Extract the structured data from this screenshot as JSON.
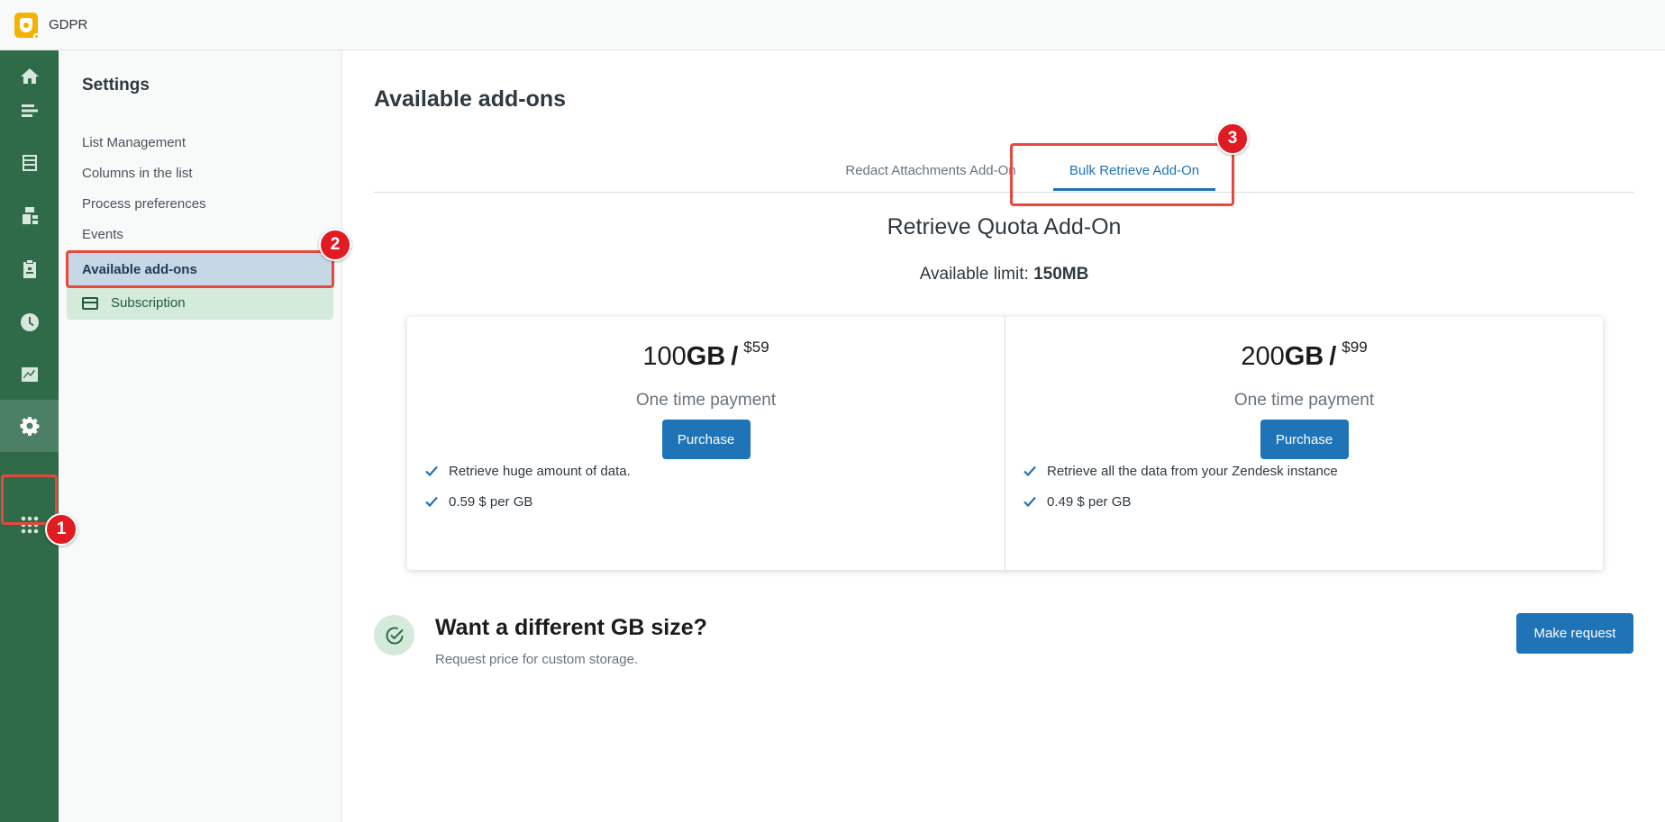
{
  "app": {
    "title": "GDPR",
    "logo_icon": "gdpr-shield-icon"
  },
  "rail": {
    "items": [
      {
        "icon": "home-icon"
      },
      {
        "icon": "list-icon"
      },
      {
        "icon": "inbox-icon"
      },
      {
        "icon": "users-icon"
      },
      {
        "icon": "clipboard-icon"
      },
      {
        "icon": "clock-icon"
      },
      {
        "icon": "chart-icon"
      },
      {
        "icon": "user-lock-icon"
      },
      {
        "icon": "gear-icon",
        "active": true
      },
      {
        "icon": "apps-grid-icon"
      }
    ]
  },
  "settings": {
    "title": "Settings",
    "items": [
      {
        "label": "List Management"
      },
      {
        "label": "Columns in the list"
      },
      {
        "label": "Process preferences"
      },
      {
        "label": "Events"
      },
      {
        "label": "Available add-ons",
        "selected": true
      },
      {
        "label": "Subscription",
        "icon": "credit-card-icon"
      }
    ]
  },
  "main": {
    "title": "Available add-ons",
    "tabs": [
      {
        "label": "Redact Attachments Add-On"
      },
      {
        "label": "Bulk Retrieve Add-On",
        "active": true
      }
    ],
    "quota_title": "Retrieve Quota Add-On",
    "limit_label": "Available limit:",
    "limit_value": "150MB",
    "plans": [
      {
        "amount": "100",
        "unit": "GB",
        "separator": "/",
        "price": "$59",
        "payment": "One time payment",
        "button": "Purchase",
        "features": [
          "Retrieve huge amount of data.",
          "0.59 $ per GB"
        ]
      },
      {
        "amount": "200",
        "unit": "GB",
        "separator": "/",
        "price": "$99",
        "payment": "One time payment",
        "button": "Purchase",
        "features": [
          "Retrieve all the data from your Zendesk instance",
          "0.49 $ per GB"
        ]
      }
    ],
    "custom": {
      "title": "Want a different GB size?",
      "subtitle": "Request price for custom storage.",
      "button": "Make request"
    }
  },
  "annotations": [
    {
      "number": "1"
    },
    {
      "number": "2"
    },
    {
      "number": "3"
    }
  ],
  "colors": {
    "rail": "#2f6b48",
    "accent": "#1f73b7",
    "highlight": "#e8483d",
    "badge": "#e11b22"
  }
}
